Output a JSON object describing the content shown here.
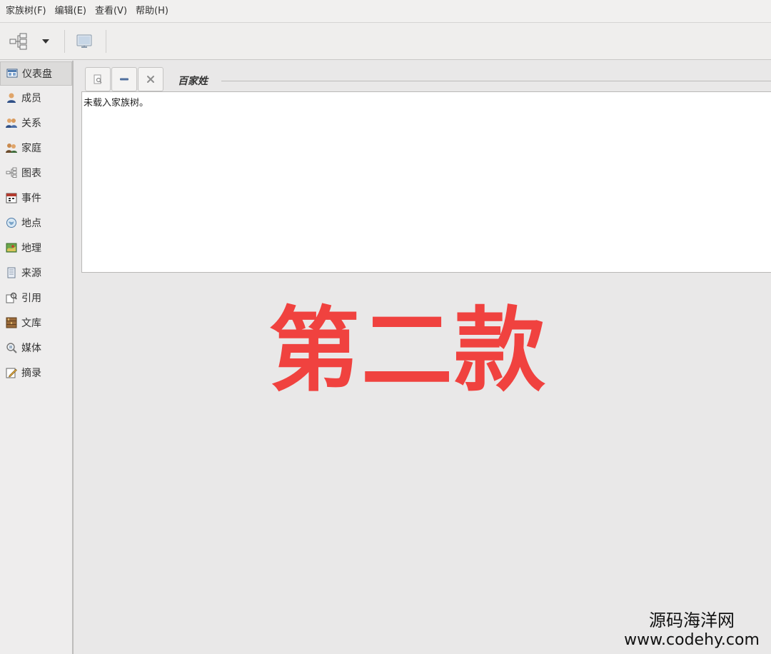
{
  "menubar": {
    "items": [
      "家族树(F)",
      "编辑(E)",
      "查看(V)",
      "帮助(H)"
    ]
  },
  "toolbar": {
    "icons": [
      "tree-view-icon",
      "dropdown-arrow-icon",
      "config-view-icon"
    ]
  },
  "sidebar": {
    "items": [
      {
        "label": "仪表盘",
        "icon": "dashboard-icon",
        "active": true
      },
      {
        "label": "成员",
        "icon": "person-icon"
      },
      {
        "label": "关系",
        "icon": "relationships-icon"
      },
      {
        "label": "家庭",
        "icon": "family-icon"
      },
      {
        "label": "图表",
        "icon": "chart-icon"
      },
      {
        "label": "事件",
        "icon": "calendar-icon"
      },
      {
        "label": "地点",
        "icon": "globe-icon"
      },
      {
        "label": "地理",
        "icon": "map-icon"
      },
      {
        "label": "来源",
        "icon": "source-icon"
      },
      {
        "label": "引用",
        "icon": "citation-icon"
      },
      {
        "label": "文库",
        "icon": "repository-icon"
      },
      {
        "label": "媒体",
        "icon": "media-icon"
      },
      {
        "label": "摘录",
        "icon": "note-icon"
      }
    ]
  },
  "gramplet": {
    "title": "百家姓",
    "body_text": "未载入家族树。",
    "buttons": [
      "properties-icon",
      "minimize-icon",
      "close-icon"
    ]
  },
  "overlay": {
    "text": "第二款"
  },
  "watermark": {
    "line1": "源码海洋网",
    "line2": "www.codehy.com"
  },
  "colors": {
    "overlay_red": "#f0423f",
    "background": "#e9e8e8"
  }
}
